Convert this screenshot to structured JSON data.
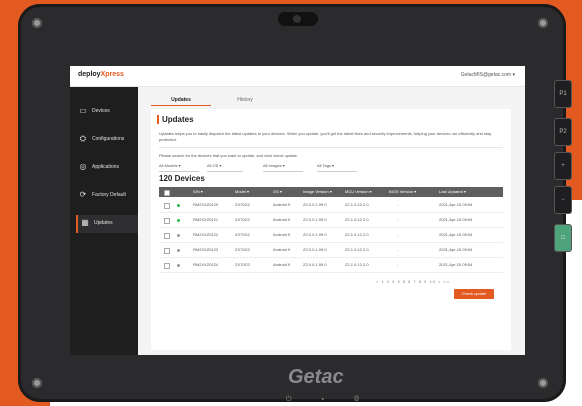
{
  "brand": "Getac",
  "side_buttons": [
    "P1",
    "P2",
    "+",
    "−",
    "□"
  ],
  "app": {
    "logo_text": "deploy",
    "logo_accent": "Xpress",
    "user_email": "GetacMIS@getac.com"
  },
  "sidebar": {
    "items": [
      {
        "label": "Devices",
        "icon": "devices-icon",
        "glyph": "▭"
      },
      {
        "label": "Configurations",
        "icon": "config-icon",
        "glyph": "⛭"
      },
      {
        "label": "Applications",
        "icon": "apps-icon",
        "glyph": "◎"
      },
      {
        "label": "Factory Default",
        "icon": "factory-icon",
        "glyph": "⟳"
      },
      {
        "label": "Updates",
        "icon": "updates-icon",
        "glyph": "▦"
      }
    ]
  },
  "tabs": [
    "Updates",
    "History"
  ],
  "panel": {
    "title": "Updates",
    "description": "Updates helps you to easily dispatch the latest updates to your devices. When you update, you'll get the latest fixes and security improvements, helping your devices run efficiently and stay protected.",
    "search_text": "Please search for the devices that you want to update, and click check update.",
    "filters": [
      "All Models",
      "All OS",
      "All Images",
      "All Tags"
    ],
    "count_label": "120 Devices"
  },
  "table": {
    "headers": [
      "S/N",
      "Model",
      "OS",
      "Image Version",
      "MCU Version",
      "BIOS Version",
      "Last Updated"
    ],
    "rows": [
      {
        "sn": "RM2XXZ0120",
        "model": "ZX70G2",
        "os": "Android 9",
        "image": "Z2.0.0.1.99.0",
        "mcu": "Z2.1.0.12.2.0",
        "bios": "-",
        "updated": "2021-Apr-15 09:54",
        "online": true
      },
      {
        "sn": "RM2XXZ0121",
        "model": "ZX70G2",
        "os": "Android 9",
        "image": "Z2.0.0.1.99.0",
        "mcu": "Z2.1.0.12.2.0",
        "bios": "-",
        "updated": "2021-Apr-15 09:54",
        "online": true
      },
      {
        "sn": "RM2XXZ0122",
        "model": "ZX70G2",
        "os": "Android 9",
        "image": "Z2.0.0.1.99.0",
        "mcu": "Z2.1.0.12.2.0",
        "bios": "-",
        "updated": "2021-Apr-15 09:54",
        "online": false
      },
      {
        "sn": "RM2XXZ0123",
        "model": "ZX70G2",
        "os": "Android 9",
        "image": "Z2.0.0.1.99.0",
        "mcu": "Z2.1.0.12.2.0",
        "bios": "-",
        "updated": "2021-Apr-15 09:54",
        "online": false
      },
      {
        "sn": "RM2XXZ0124",
        "model": "ZX70G2",
        "os": "Android 9",
        "image": "Z2.0.0.1.99.0",
        "mcu": "Z2.1.0.12.2.0",
        "bios": "-",
        "updated": "2021-Apr-15 09:54",
        "online": false
      }
    ]
  },
  "pager": "< 1 2 3 4 5 6 7 8 9 10 > >>",
  "check_update_label": "Check update",
  "colors": {
    "accent": "#e35a20",
    "online": "#2fb84a",
    "offline": "#9a9a9a"
  }
}
